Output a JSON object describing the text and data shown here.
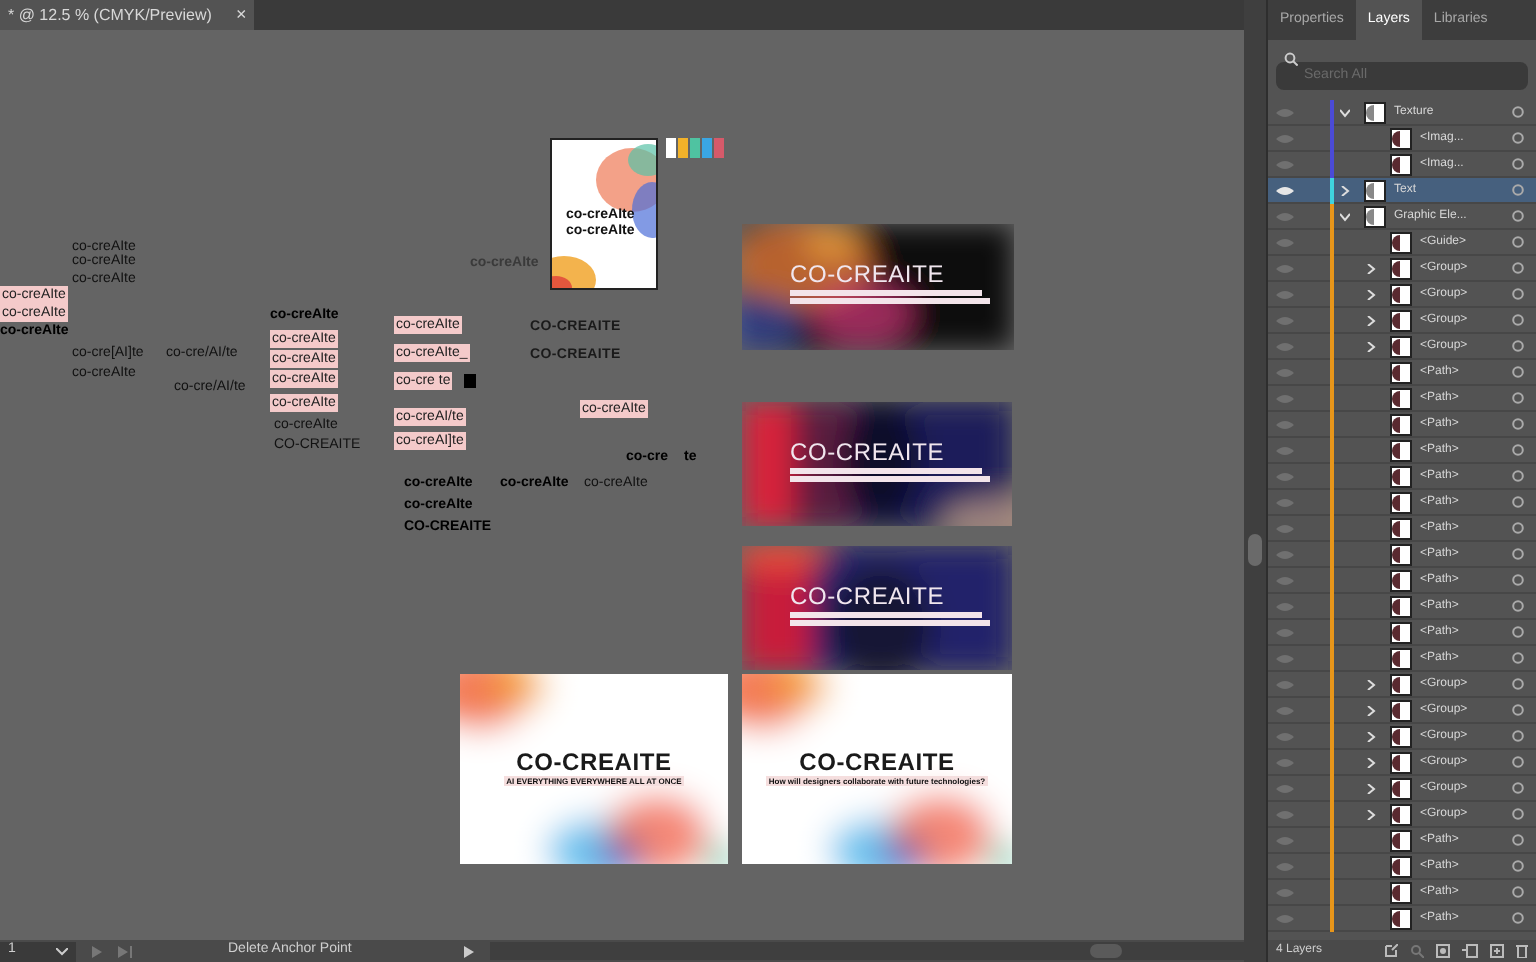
{
  "document_tab": {
    "title": "* @ 12.5 % (CMYK/Preview)",
    "close": "×"
  },
  "canvas": {
    "texts": [
      {
        "text": "co-creAIte",
        "kind": "plain"
      },
      {
        "text": "co-creAIte",
        "kind": "plain"
      },
      {
        "text": "co-creAIte",
        "kind": "plain"
      },
      {
        "text": "co-creAIte",
        "kind": "highlight"
      },
      {
        "text": "co-creAIte",
        "kind": "highlight"
      },
      {
        "text": "co-creAIte",
        "kind": "bold"
      },
      {
        "text": "co-cre[AI]te",
        "kind": "plain"
      },
      {
        "text": "co-cre/AI/te",
        "kind": "plain"
      },
      {
        "text": "co-creAIte",
        "kind": "plain"
      },
      {
        "text": "co-cre/AI/te",
        "kind": "plain"
      },
      {
        "text": "co-creAIte",
        "kind": "bold"
      },
      {
        "text": "co-creAIte",
        "kind": "highlight"
      },
      {
        "text": "co-creAIte",
        "kind": "highlight"
      },
      {
        "text": "co-creAIte",
        "kind": "highlight"
      },
      {
        "text": "co-creAIte",
        "kind": "highlight"
      },
      {
        "text": "co-creAIte",
        "kind": "plain"
      },
      {
        "text": "CO-CREAITE",
        "kind": "plain"
      },
      {
        "text": "co-creAIte",
        "kind": "highlight"
      },
      {
        "text": "co-creAIte_",
        "kind": "highlight"
      },
      {
        "text": "co-cre te",
        "kind": "highlight"
      },
      {
        "text": "co-creAI/te",
        "kind": "highlight"
      },
      {
        "text": "co-creAI]te",
        "kind": "highlight"
      },
      {
        "text": "co-creAIte",
        "kind": "muted"
      },
      {
        "text": "CO-CREAITE",
        "kind": "caps"
      },
      {
        "text": "CO-CREAITE",
        "kind": "caps"
      },
      {
        "text": "co-creAIte",
        "kind": "highlight"
      },
      {
        "text": "co-cre",
        "kind": "bold"
      },
      {
        "text": "te",
        "kind": "bold"
      },
      {
        "text": "co-creAIte",
        "kind": "bold"
      },
      {
        "text": "co-creAIte",
        "kind": "bold"
      },
      {
        "text": "co-creAIte",
        "kind": "plain"
      },
      {
        "text": "co-creAIte",
        "kind": "bold"
      },
      {
        "text": "CO-CREAITE",
        "kind": "bold"
      }
    ],
    "poster": {
      "lines": [
        "co-creAIte",
        "co-creAIte"
      ]
    },
    "swatches": [
      {
        "color": "#ffffff"
      },
      {
        "color": "#f2b22a"
      },
      {
        "color": "#4fc3a1"
      },
      {
        "color": "#3aa6e3"
      },
      {
        "color": "#d65a6a"
      }
    ],
    "artboards": [
      {
        "kind": "dark",
        "title": "CO-CREAITE"
      },
      {
        "kind": "dark",
        "title": "CO-CREAITE"
      },
      {
        "kind": "dark",
        "title": "CO-CREAITE"
      },
      {
        "kind": "light",
        "title": "CO-CREAITE",
        "subtitle": "AI EVERYTHING EVERYWHERE ALL AT ONCE"
      },
      {
        "kind": "light",
        "title": "CO-CREAITE",
        "subtitle": "How will designers collaborate with future technologies?"
      }
    ]
  },
  "panel": {
    "tabs": [
      {
        "label": "Properties",
        "selected": false
      },
      {
        "label": "Layers",
        "selected": true
      },
      {
        "label": "Libraries",
        "selected": false
      }
    ],
    "search": {
      "placeholder": "Search All"
    },
    "layers": [
      {
        "name": "Texture",
        "color": "#4b4bd6",
        "selected": false,
        "expanded": true,
        "children": [
          {
            "name": "<Imag..."
          },
          {
            "name": "<Imag..."
          }
        ]
      },
      {
        "name": "Text",
        "color": "#3fd3df",
        "selected": true,
        "expanded": false
      },
      {
        "name": "Graphic Ele...",
        "color": "#e8961a",
        "selected": false,
        "expanded": true,
        "children": [
          {
            "name": "<Guide>"
          },
          {
            "name": "<Group>",
            "expanded": false
          },
          {
            "name": "<Group>",
            "expanded": false
          },
          {
            "name": "<Group>",
            "expanded": false
          },
          {
            "name": "<Group>",
            "expanded": false
          },
          {
            "name": "<Path>"
          },
          {
            "name": "<Path>"
          },
          {
            "name": "<Path>"
          },
          {
            "name": "<Path>"
          },
          {
            "name": "<Path>"
          },
          {
            "name": "<Path>"
          },
          {
            "name": "<Path>"
          },
          {
            "name": "<Path>"
          },
          {
            "name": "<Path>"
          },
          {
            "name": "<Path>"
          },
          {
            "name": "<Path>"
          },
          {
            "name": "<Path>"
          },
          {
            "name": "<Group>",
            "expanded": false
          },
          {
            "name": "<Group>",
            "expanded": false
          },
          {
            "name": "<Group>",
            "expanded": false
          },
          {
            "name": "<Group>",
            "expanded": false
          },
          {
            "name": "<Group>",
            "expanded": false
          },
          {
            "name": "<Group>",
            "expanded": false
          },
          {
            "name": "<Path>"
          },
          {
            "name": "<Path>"
          },
          {
            "name": "<Path>"
          },
          {
            "name": "<Path>"
          }
        ]
      }
    ],
    "footer": "4 Layers"
  },
  "status_bar": {
    "page": "1",
    "message": "Delete Anchor Point"
  }
}
